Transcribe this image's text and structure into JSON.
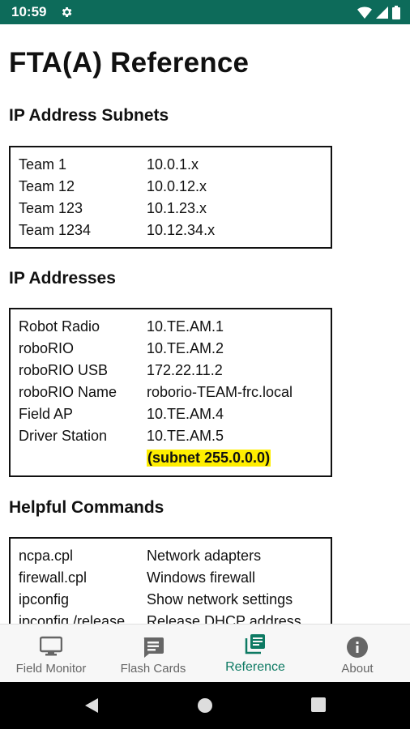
{
  "status_bar": {
    "time": "10:59",
    "icons": [
      "settings-icon",
      "wifi-icon",
      "signal-icon",
      "battery-icon"
    ],
    "color": "#0d6b5a"
  },
  "page": {
    "title": "FTA(A) Reference"
  },
  "sections": {
    "subnets": {
      "title": "IP Address Subnets",
      "rows": [
        {
          "key": "Team 1",
          "value": "10.0.1.x"
        },
        {
          "key": "Team 12",
          "value": "10.0.12.x"
        },
        {
          "key": "Team 123",
          "value": "10.1.23.x"
        },
        {
          "key": "Team 1234",
          "value": "10.12.34.x"
        }
      ]
    },
    "addresses": {
      "title": "IP Addresses",
      "rows": [
        {
          "key": "Robot Radio",
          "value": "10.TE.AM.1"
        },
        {
          "key": "roboRIO",
          "value": "10.TE.AM.2"
        },
        {
          "key": "roboRIO USB",
          "value": "172.22.11.2"
        },
        {
          "key": "roboRIO Name",
          "value": "roborio-TEAM-frc.local"
        },
        {
          "key": "Field AP",
          "value": "10.TE.AM.4"
        },
        {
          "key": "Driver Station",
          "value": "10.TE.AM.5"
        }
      ],
      "note": "(subnet 255.0.0.0)",
      "note_color": "#ffee00"
    },
    "commands": {
      "title": "Helpful Commands",
      "rows": [
        {
          "key": "ncpa.cpl",
          "value": "Network adapters"
        },
        {
          "key": "firewall.cpl",
          "value": "Windows firewall"
        },
        {
          "key": "ipconfig",
          "value": "Show network settings"
        },
        {
          "key": "ipconfig /release",
          "value": "Release DHCP address"
        }
      ]
    }
  },
  "bottom_nav": {
    "items": [
      {
        "label": "Field Monitor",
        "icon": "monitor-icon",
        "active": false
      },
      {
        "label": "Flash Cards",
        "icon": "flash-cards-icon",
        "active": false
      },
      {
        "label": "Reference",
        "icon": "reference-icon",
        "active": true
      },
      {
        "label": "About",
        "icon": "info-icon",
        "active": false
      }
    ],
    "active_color": "#0d7a63"
  }
}
